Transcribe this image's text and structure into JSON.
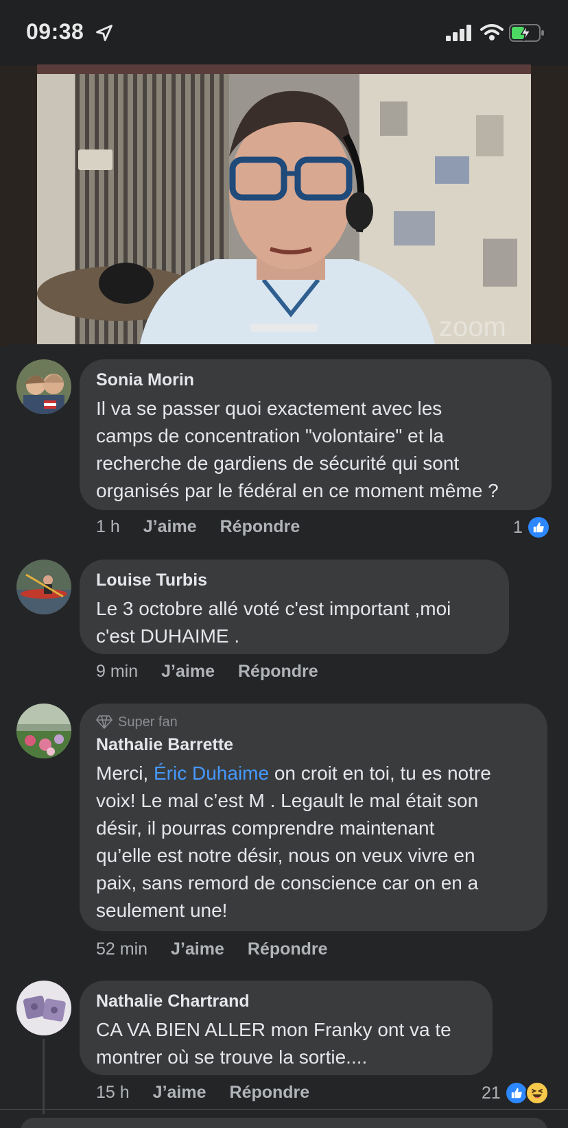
{
  "status_bar": {
    "time": "09:38",
    "icons": [
      "location-arrow-icon",
      "signal-bars-icon",
      "wifi-icon",
      "battery-charging-icon"
    ]
  },
  "video": {
    "watermark": "zoom"
  },
  "comments": [
    {
      "author": "Sonia Morin",
      "text": "Il va se passer quoi exactement avec les camps de concentration \"volontaire\" et la recherche de gardiens de sécurité qui sont organisés par le fédéral en ce moment même ?",
      "lines": [
        "Il va se passer quoi exactement avec les",
        "camps de concentration \"volontaire\" et la",
        "recherche de gardiens de sécurité qui sont",
        "organisés par le fédéral en ce moment même ?"
      ],
      "time": "1 h",
      "like_label": "J’aime",
      "reply_label": "Répondre",
      "reaction_count": "1",
      "reactions": [
        "like"
      ]
    },
    {
      "author": "Louise Turbis",
      "lines": [
        "Le 3 octobre allé voté c'est important ,moi",
        "c'est DUHAIME ."
      ],
      "time": "9 min",
      "like_label": "J’aime",
      "reply_label": "Répondre"
    },
    {
      "badge": "Super fan",
      "author": "Nathalie Barrette",
      "line1_prefix": "Merci, ",
      "mention": "Éric Duhaime",
      "line1_suffix": " on croit en toi, tu es notre",
      "lines": [
        "voix! Le mal c’est M . Legault  le mal était son",
        "désir, il pourras comprendre maintenant",
        "qu’elle est notre désir, nous on veux vivre en",
        "paix, sans remord de conscience car on en a",
        "seulement une!"
      ],
      "time": "52 min",
      "like_label": "J’aime",
      "reply_label": "Répondre"
    },
    {
      "author": "Nathalie Chartrand",
      "lines": [
        "CA VA BIEN ALLER mon Franky ont va te",
        "montrer où se trouve la sortie...."
      ],
      "time": "15 h",
      "like_label": "J’aime",
      "reply_label": "Répondre",
      "reaction_count": "21",
      "reactions": [
        "like",
        "haha"
      ]
    }
  ]
}
